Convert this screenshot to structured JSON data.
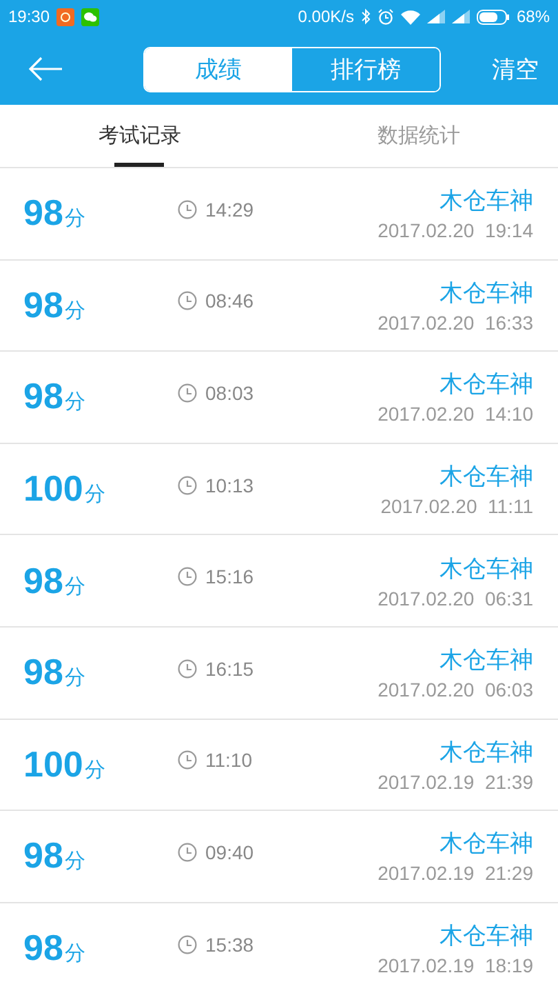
{
  "status_bar": {
    "time": "19:30",
    "speed": "0.00K/s",
    "battery": "68%"
  },
  "header": {
    "segments": [
      {
        "label": "成绩",
        "selected": true
      },
      {
        "label": "排行榜",
        "selected": false
      }
    ],
    "action": "清空"
  },
  "tabs": [
    {
      "label": "考试记录",
      "selected": true
    },
    {
      "label": "数据统计",
      "selected": false
    }
  ],
  "records": [
    {
      "score": "98",
      "unit": "分",
      "duration": "14:29",
      "name": "木仓车神",
      "date": "2017.02.20  19:14"
    },
    {
      "score": "98",
      "unit": "分",
      "duration": "08:46",
      "name": "木仓车神",
      "date": "2017.02.20  16:33"
    },
    {
      "score": "98",
      "unit": "分",
      "duration": "08:03",
      "name": "木仓车神",
      "date": "2017.02.20  14:10"
    },
    {
      "score": "100",
      "unit": "分",
      "duration": "10:13",
      "name": "木仓车神",
      "date": "2017.02.20  11:11"
    },
    {
      "score": "98",
      "unit": "分",
      "duration": "15:16",
      "name": "木仓车神",
      "date": "2017.02.20  06:31"
    },
    {
      "score": "98",
      "unit": "分",
      "duration": "16:15",
      "name": "木仓车神",
      "date": "2017.02.20  06:03"
    },
    {
      "score": "100",
      "unit": "分",
      "duration": "11:10",
      "name": "木仓车神",
      "date": "2017.02.19  21:39"
    },
    {
      "score": "98",
      "unit": "分",
      "duration": "09:40",
      "name": "木仓车神",
      "date": "2017.02.19  21:29"
    },
    {
      "score": "98",
      "unit": "分",
      "duration": "15:38",
      "name": "木仓车神",
      "date": "2017.02.19  18:19"
    }
  ]
}
